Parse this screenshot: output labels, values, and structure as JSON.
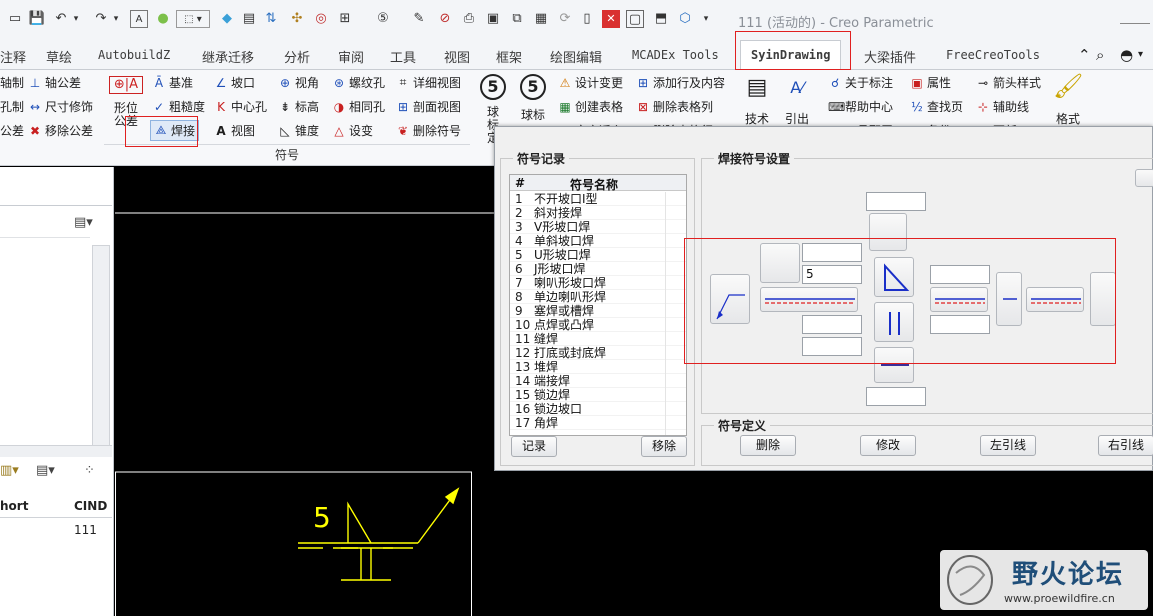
{
  "window": {
    "title": "111 (活动的) - Creo Parametric"
  },
  "quick_access": {
    "icons": [
      "new-icon",
      "save-icon",
      "undo-icon",
      "redo-icon",
      "text-style-icon",
      "color-icon",
      "select-box-icon",
      "eraser-icon",
      "sheet-icon",
      "regenerate-icon",
      "tool-icon",
      "target-icon",
      "relation-icon",
      "number-icon",
      "edit-icon",
      "print-icon",
      "export-icon",
      "copy-icon",
      "table-icon",
      "forbid-icon",
      "close-window-icon",
      "window-icon",
      "view-icon",
      "3d-box-icon"
    ]
  },
  "tabs": [
    "注释",
    "草绘",
    "AutobuildZ",
    "继承迁移",
    "分析",
    "审阅",
    "工具",
    "视图",
    "框架",
    "绘图编辑",
    "MCADEx Tools",
    "SyinDrawing",
    "大梁插件",
    "FreeCreoTools"
  ],
  "active_tab": "SyinDrawing",
  "ribbon": {
    "left_col": [
      "轴制",
      "孔制",
      "公差"
    ],
    "col1": [
      "轴公差",
      "尺寸修饰",
      "移除公差"
    ],
    "big_geo_label": "形位公差",
    "col2": [
      "基准",
      "粗糙度",
      "焊接"
    ],
    "col3": [
      "坡口",
      "中心孔",
      "视图"
    ],
    "col4": [
      "视角",
      "标高",
      "锥度"
    ],
    "col5": [
      "螺纹孔",
      "相同孔",
      "设变"
    ],
    "col6": [
      "详细视图",
      "剖面视图",
      "删除符号"
    ],
    "big_ball1": "球标定",
    "big_ball2": "球标",
    "col7": [
      "设计变更",
      "创建表格",
      "文字适么"
    ],
    "col8": [
      "添加行及内容",
      "删除表格列",
      "删除表格行"
    ],
    "big_tech": "技术",
    "big_lead": "引出",
    "col9": [
      "关于标注",
      "帮助中心",
      "工具配置"
    ],
    "col10": [
      "属性",
      "查找页",
      "备份"
    ],
    "col11": [
      "箭头样式",
      "辅助线",
      "更新"
    ],
    "big_format": "格式",
    "group_label": "符号"
  },
  "left_panel": {
    "col_short": "hort",
    "col_cind": "CIND",
    "value": "111"
  },
  "drawing": {
    "weld_value": "5"
  },
  "dialog": {
    "records": {
      "title": "符号记录",
      "col_num": "#",
      "col_name": "符号名称",
      "rows": [
        {
          "n": "1",
          "name": "不开坡口I型"
        },
        {
          "n": "2",
          "name": "斜对接焊"
        },
        {
          "n": "3",
          "name": "V形坡口焊"
        },
        {
          "n": "4",
          "name": "单斜坡口焊"
        },
        {
          "n": "5",
          "name": "U形坡口焊"
        },
        {
          "n": "6",
          "name": "J形坡口焊"
        },
        {
          "n": "7",
          "name": "喇叭形坡口焊"
        },
        {
          "n": "8",
          "name": "单边喇叭形焊"
        },
        {
          "n": "9",
          "name": "塞焊或槽焊"
        },
        {
          "n": "10",
          "name": "点焊或凸焊"
        },
        {
          "n": "11",
          "name": "缝焊"
        },
        {
          "n": "12",
          "name": "打底或封底焊"
        },
        {
          "n": "13",
          "name": "堆焊"
        },
        {
          "n": "14",
          "name": "端接焊"
        },
        {
          "n": "15",
          "name": "锁边焊"
        },
        {
          "n": "16",
          "name": "锁边坡口"
        },
        {
          "n": "17",
          "name": "角焊"
        }
      ],
      "record_button": "记录",
      "remove_button": "移除"
    },
    "settings": {
      "title": "焊接符号设置",
      "size_value": "5"
    },
    "definition": {
      "title": "符号定义",
      "delete_button": "删除",
      "modify_button": "修改",
      "left_leader_button": "左引线",
      "right_leader_button": "右引线"
    }
  },
  "watermark": {
    "name": "野火论坛",
    "url": "www.proewildfire.cn"
  },
  "colors": {
    "highlight_red": "#e02020",
    "drawing_yellow": "#ffff00",
    "symbol_blue": "#1a2fc8"
  }
}
